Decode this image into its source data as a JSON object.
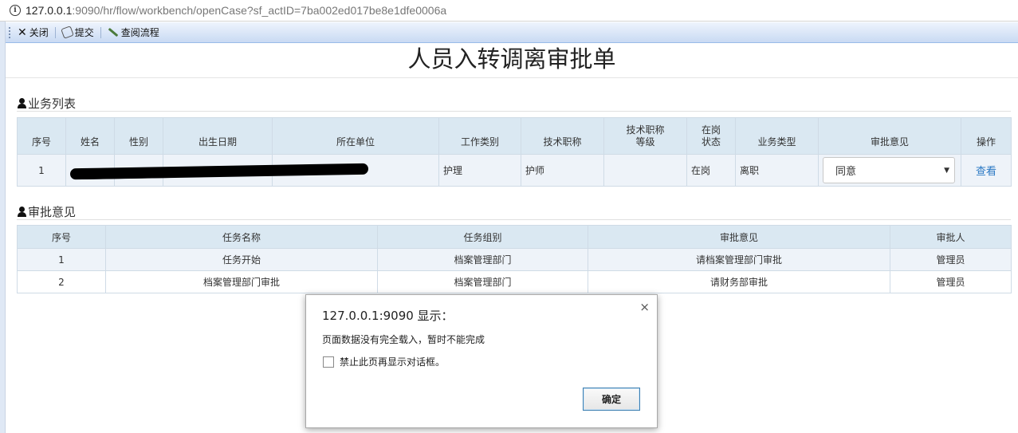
{
  "browser": {
    "url_host": "127.0.0.1",
    "url_rest": ":9090/hr/flow/workbench/openCase?sf_actID=7ba002ed017be8e1dfe0006a"
  },
  "toolbar": {
    "close_label": "关闭",
    "submit_label": "提交",
    "flow_label": "查阅流程"
  },
  "page_title": "人员入转调离审批单",
  "business_section": {
    "heading": "业务列表",
    "columns": [
      "序号",
      "姓名",
      "性别",
      "出生日期",
      "所在单位",
      "工作类别",
      "技术职称",
      "技术职称\n等级",
      "在岗\n状态",
      "业务类型",
      "审批意见",
      "操作"
    ],
    "rows": [
      {
        "index": "1",
        "name": "",
        "gender": "",
        "birth_date": "",
        "unit": "",
        "work_category": "护理",
        "tech_title": "护师",
        "tech_level": "",
        "status": "在岗",
        "business_type": "离职",
        "opinion": "同意",
        "action": "查看"
      }
    ]
  },
  "approval_section": {
    "heading": "审批意见",
    "columns": [
      "序号",
      "任务名称",
      "任务组别",
      "审批意见",
      "审批人"
    ],
    "rows": [
      {
        "index": "1",
        "task": "任务开始",
        "group": "档案管理部门",
        "opinion": "请档案管理部门审批",
        "approver": "管理员"
      },
      {
        "index": "2",
        "task": "档案管理部门审批",
        "group": "档案管理部门",
        "opinion": "请财务部审批",
        "approver": "管理员"
      }
    ]
  },
  "dialog": {
    "title": "127.0.0.1:9090 显示：",
    "message": "页面数据没有完全载入，暂时不能完成",
    "checkbox_label": "禁止此页再显示对话框。",
    "ok_label": "确定",
    "close_symbol": "×"
  }
}
